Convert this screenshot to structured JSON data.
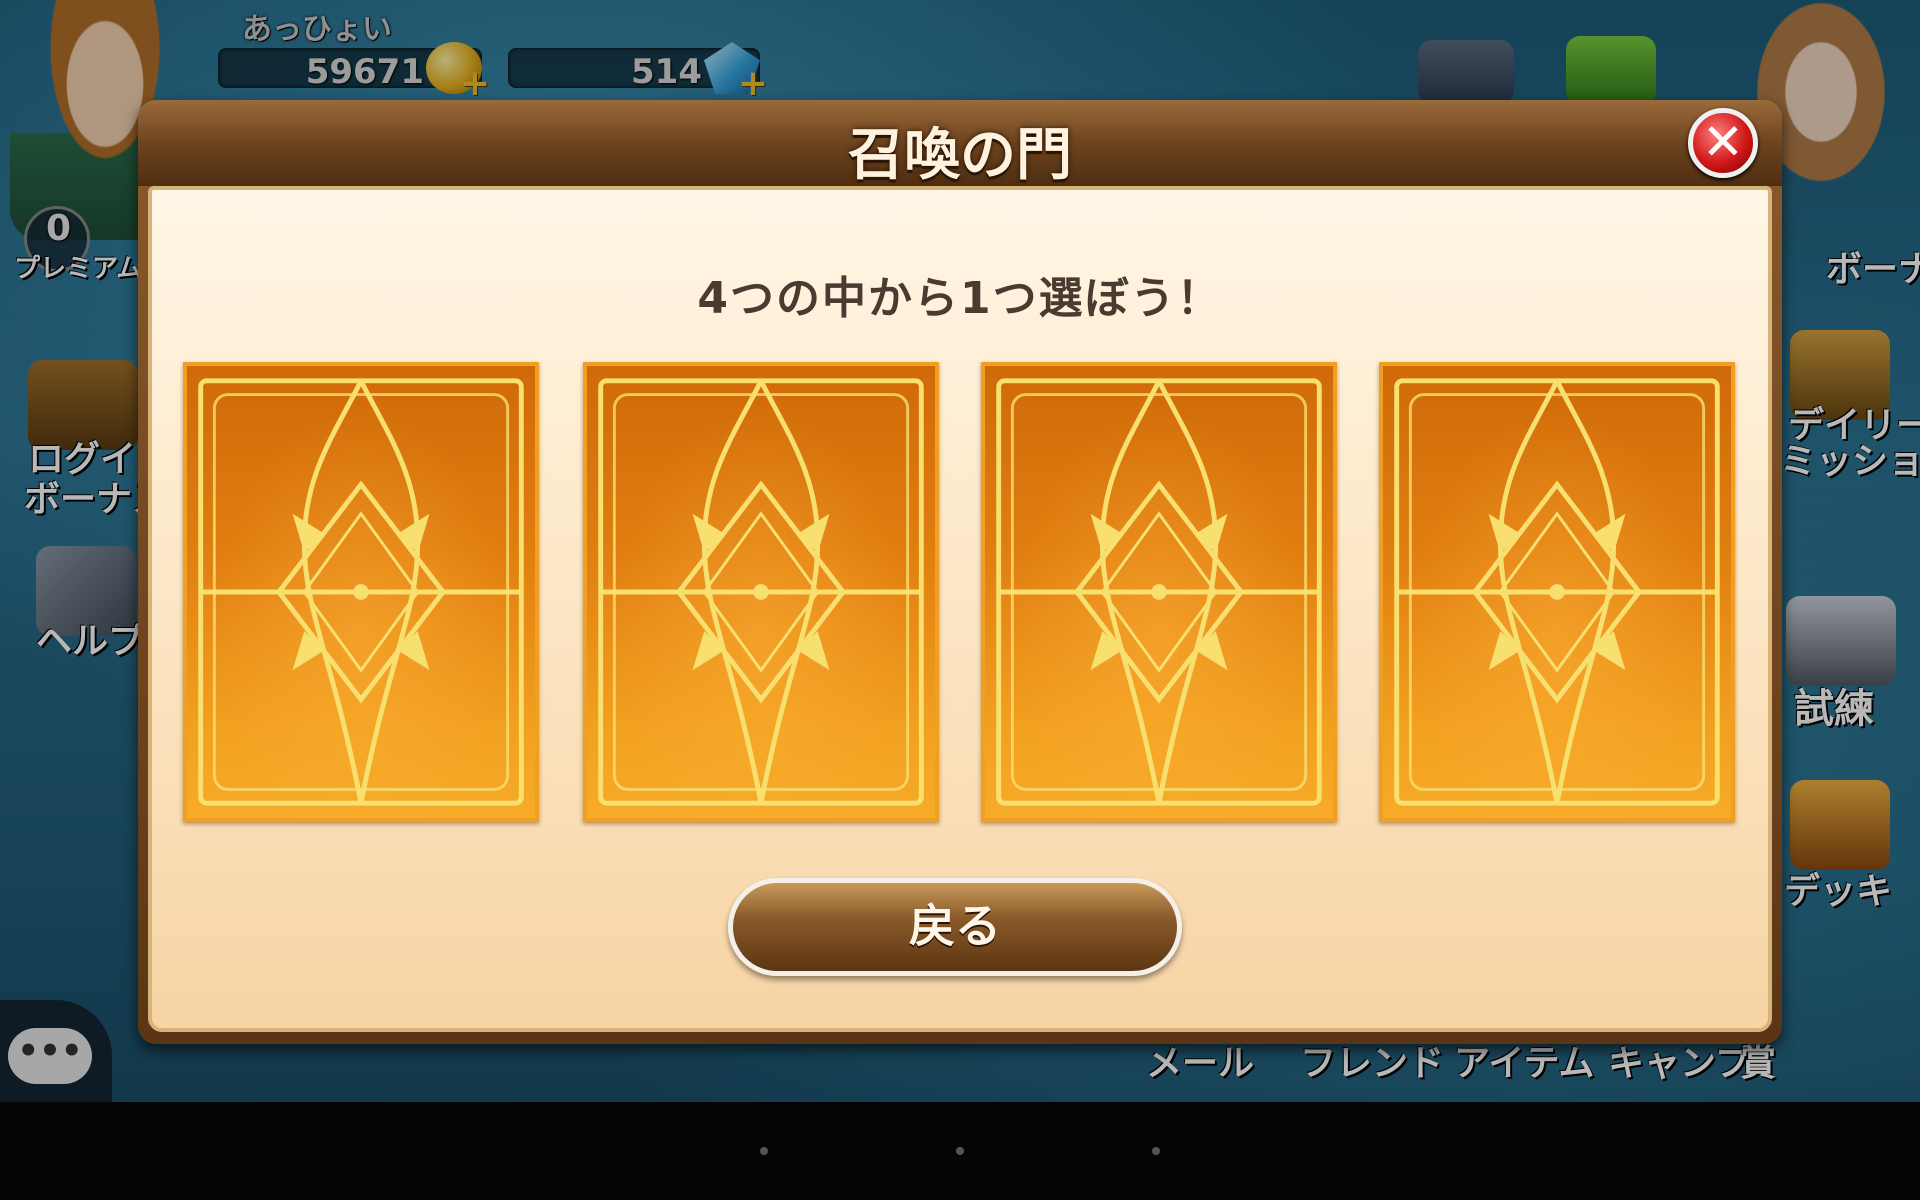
{
  "background": {
    "player_name": "あっひょい",
    "gold": "59671",
    "gems": "514",
    "premium_count": "0",
    "premium_label": "プレミアム",
    "left_menu": [
      "ログイン",
      "ボーナス",
      "ヘルプ"
    ],
    "right_menu": [
      "ボーナス",
      "デイリー",
      "ミッション",
      "試練",
      "デッキ"
    ],
    "bottom_menu": [
      "メール",
      "フレンド",
      "アイテム",
      "キャンプ",
      "賞"
    ],
    "top_icons": [
      "gift-icon",
      "chest-icon"
    ]
  },
  "dialog": {
    "title": "召喚の門",
    "instruction": "4つの中から1つ選ぼう！",
    "card_count": 4,
    "back_button": "戻る",
    "close_symbol": "✕"
  },
  "colors": {
    "dialog_frame": "#6e4420",
    "card_orange": "#e07d10",
    "card_gold_ornament": "#f8e070"
  }
}
